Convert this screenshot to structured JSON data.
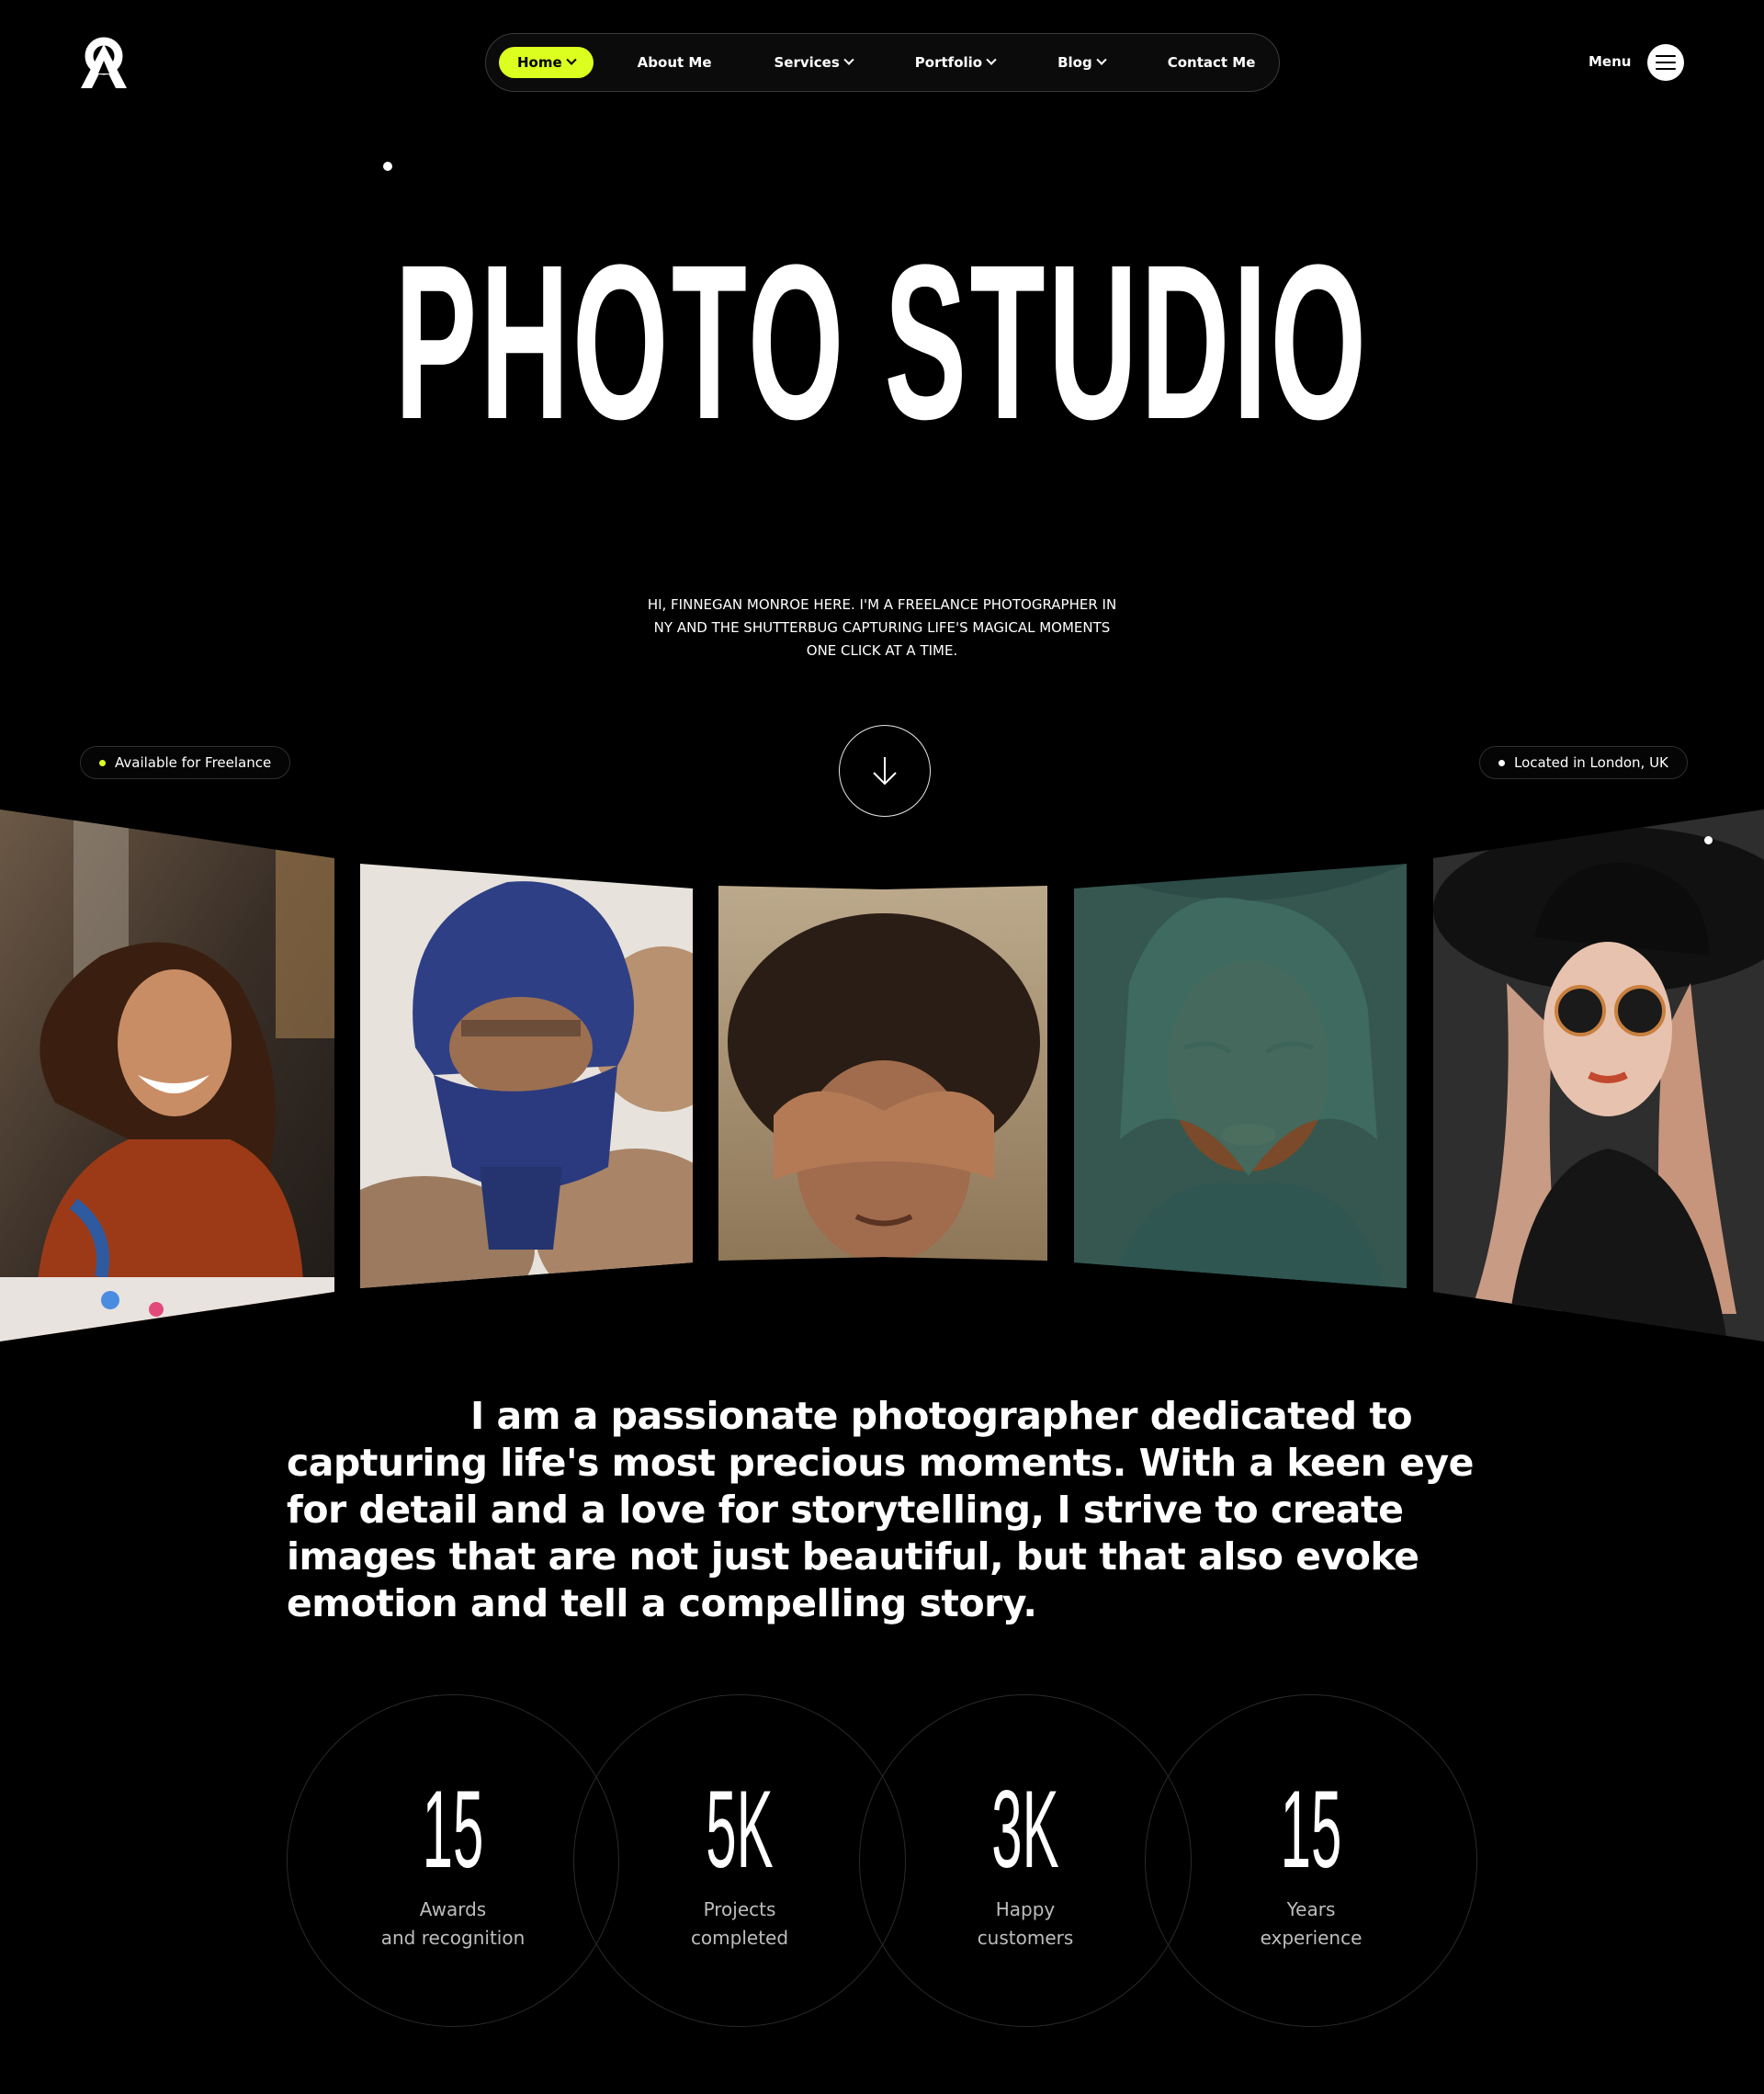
{
  "nav": {
    "items": [
      {
        "label": "Home",
        "has_dropdown": true,
        "active": true
      },
      {
        "label": "About Me",
        "has_dropdown": false
      },
      {
        "label": "Services",
        "has_dropdown": true
      },
      {
        "label": "Portfolio",
        "has_dropdown": true
      },
      {
        "label": "Blog",
        "has_dropdown": true
      },
      {
        "label": "Contact Me",
        "has_dropdown": false
      }
    ],
    "menu_label": "Menu"
  },
  "hero": {
    "title": "PHOTO STUDIO",
    "subtitle": "HI, FINNEGAN MONROE HERE. I'M A FREELANCE PHOTOGRAPHER IN NY AND THE SHUTTERBUG CAPTURING LIFE'S MAGICAL MOMENTS ONE CLICK AT A TIME.",
    "availability": "Available for Freelance",
    "location": "Located in London, UK"
  },
  "about": {
    "text": "I am a passionate photographer dedicated to capturing life's most precious moments. With a keen eye for detail and a love for storytelling, I strive to create images that are not just beautiful, but that also evoke emotion and tell a compelling story."
  },
  "stats": [
    {
      "value": "15",
      "label": "Awards\nand recognition"
    },
    {
      "value": "5K",
      "label": "Projects\ncompleted"
    },
    {
      "value": "3K",
      "label": "Happy\ncustomers"
    },
    {
      "value": "15",
      "label": "Years\nexperience"
    }
  ],
  "colors": {
    "accent": "#dcff1f",
    "background": "#000000",
    "text": "#ffffff",
    "muted": "#bdbdbd"
  },
  "icons": {
    "logo": "a-logo-icon",
    "menu": "hamburger-icon",
    "scroll": "arrow-down-icon",
    "dropdown": "chevron-down-icon"
  }
}
